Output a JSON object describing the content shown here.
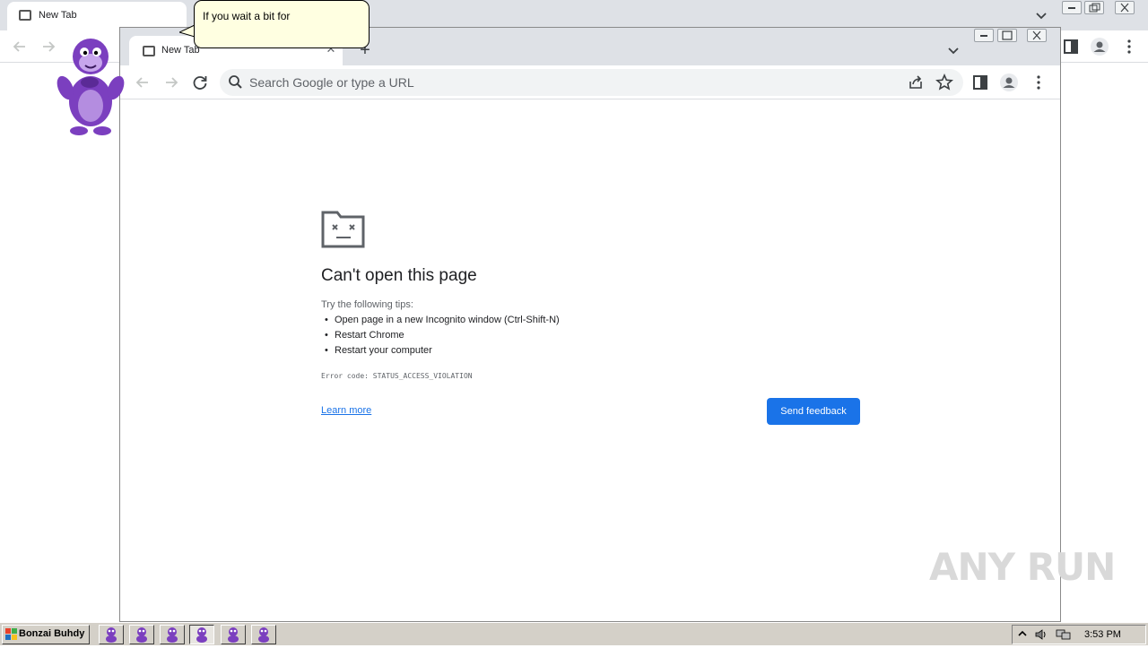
{
  "back_window": {
    "tab_title": "New Tab"
  },
  "front_window": {
    "tab_title": "New Tab",
    "tab_close_glyph": "✕",
    "new_tab_glyph": "+",
    "omnibox_placeholder": "Search Google or type a URL"
  },
  "error_page": {
    "title": "Can't open this page",
    "tips_intro": "Try the following tips:",
    "tips": [
      "Open page in a new Incognito window (Ctrl-Shift-N)",
      "Restart Chrome",
      "Restart your computer"
    ],
    "error_code": "Error code: STATUS_ACCESS_VIOLATION",
    "learn_more": "Learn more",
    "send_feedback": "Send feedback"
  },
  "bonzi": {
    "speech": "If you wait a bit for"
  },
  "watermark": "ANY RUN",
  "taskbar": {
    "start_label": "Bonzai Buhdy",
    "clock": "3:53 PM"
  },
  "colors": {
    "accent": "#1a73e8",
    "tabstrip": "#dee1e6",
    "bonzi_purple": "#7b3fbf",
    "taskbar": "#d4d0c8"
  },
  "icons": [
    "back-arrow-icon",
    "forward-arrow-icon",
    "reload-icon",
    "search-icon",
    "share-icon",
    "star-icon",
    "side-panel-icon",
    "profile-icon",
    "menu-icon",
    "sad-folder-icon",
    "windows-logo-icon",
    "bonzi-icon"
  ]
}
